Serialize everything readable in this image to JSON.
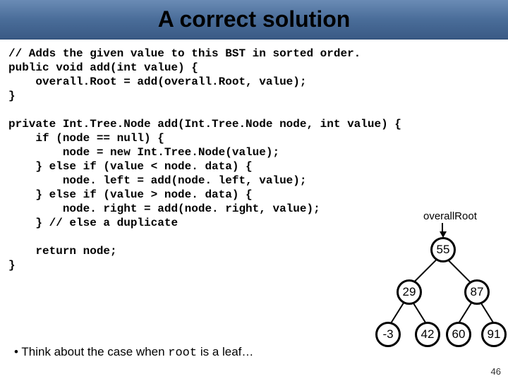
{
  "title": "A correct solution",
  "code": "// Adds the given value to this BST in sorted order.\npublic void add(int value) {\n    overall.Root = add(overall.Root, value);\n}\n\nprivate Int.Tree.Node add(Int.Tree.Node node, int value) {\n    if (node == null) {\n        node = new Int.Tree.Node(value);\n    } else if (value < node. data) {\n        node. left = add(node. left, value);\n    } else if (value > node. data) {\n        node. right = add(node. right, value);\n    } // else a duplicate\n\n    return node;\n}",
  "bullet_prefix": "• Think about the case when ",
  "bullet_code": "root",
  "bullet_suffix": " is a leaf…",
  "tree": {
    "root_label": "overallRoot",
    "nodes": {
      "n55": "55",
      "n29": "29",
      "n87": "87",
      "nm3": "-3",
      "n42": "42",
      "n60": "60",
      "n91": "91"
    }
  },
  "page_number": "46"
}
